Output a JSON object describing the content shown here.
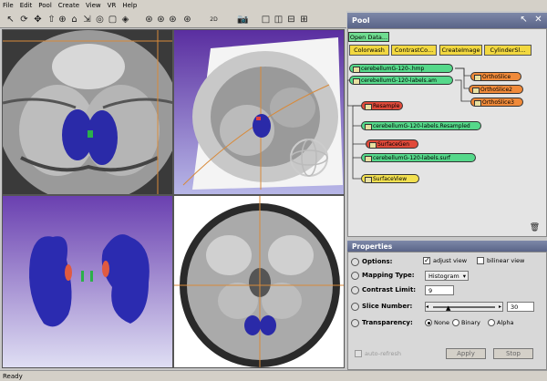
{
  "menu": [
    "File",
    "Edit",
    "Pool",
    "Create",
    "View",
    "VR",
    "Help"
  ],
  "toolbar": {
    "icons": [
      "select-arrow-icon",
      "rotate-icon",
      "pan-cross-icon",
      "move-up-icon",
      "zoom-icon",
      "home-icon",
      "measure-icon",
      "seek-icon",
      "projection-icon",
      "pick-icon",
      "view-x-icon",
      "view-y-icon",
      "view-z-icon",
      "layout-2d-icon",
      "camera-icon"
    ],
    "view_label": "2D"
  },
  "pool": {
    "title": "Pool",
    "open_data": "Open Data...",
    "modules": [
      "Colorwash",
      "ContrastCo...",
      "CreateImage",
      "CylinderSl..."
    ],
    "nodes": [
      {
        "label": "cerebellumG-120-.hmp",
        "color": "green"
      },
      {
        "label": "cerebellumG-120-labels.am",
        "color": "green"
      },
      {
        "label": "OrthoSlice",
        "color": "orange"
      },
      {
        "label": "OrthoSlice2",
        "color": "orange"
      },
      {
        "label": "OrthoSlice3",
        "color": "orange"
      },
      {
        "label": "Resample",
        "color": "red"
      },
      {
        "label": "cerebellumG-120-labels.Resampled",
        "color": "green"
      },
      {
        "label": "SurfaceGen",
        "color": "red"
      },
      {
        "label": "cerebellumG-120-labels.surf",
        "color": "green"
      },
      {
        "label": "SurfaceView",
        "color": "yellow"
      }
    ]
  },
  "properties": {
    "title": "Properties",
    "options_label": "Options:",
    "adjust_view": "adjust view",
    "bilinear_view": "bilinear view",
    "mapping_label": "Mapping Type:",
    "mapping_value": "Histogram",
    "contrast_label": "Contrast Limit:",
    "contrast_value": "9",
    "slice_label": "Slice Number:",
    "slice_value": "30",
    "transparency_label": "Transparency:",
    "transparency_options": [
      "None",
      "Binary",
      "Alpha"
    ],
    "auto_refresh": "auto-refresh",
    "apply": "Apply",
    "stop": "Stop"
  },
  "status": "Ready"
}
